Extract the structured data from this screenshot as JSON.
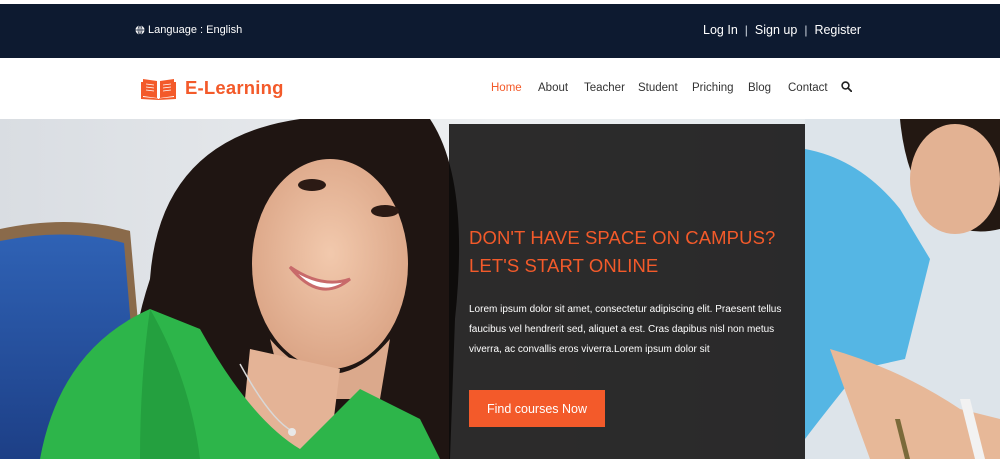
{
  "topbar": {
    "language_label": "Language : English",
    "auth_links": [
      "Log In",
      "Sign up",
      "Register"
    ]
  },
  "brand": {
    "name": "E-Learning",
    "icon": "open-book-icon",
    "accent_color": "#f35a2a",
    "topbar_color": "#0d1a30"
  },
  "nav": {
    "items": [
      "Home",
      "About",
      "Teacher",
      "Student",
      "Priching",
      "Blog",
      "Contact"
    ],
    "active": "Home",
    "search_icon": "search-icon"
  },
  "hero": {
    "headline_line1": "DON'T HAVE SPACE ON CAMPUS?",
    "headline_line2": "LET'S START ONLINE",
    "body": "Lorem ipsum dolor sit amet, consectetur adipiscing elit. Praesent tellus faucibus vel hendrerit sed, aliquet a est. Cras dapibus nisl non metus viverra, ac convallis eros viverra.Lorem ipsum dolor sit",
    "cta_label": "Find courses Now"
  }
}
